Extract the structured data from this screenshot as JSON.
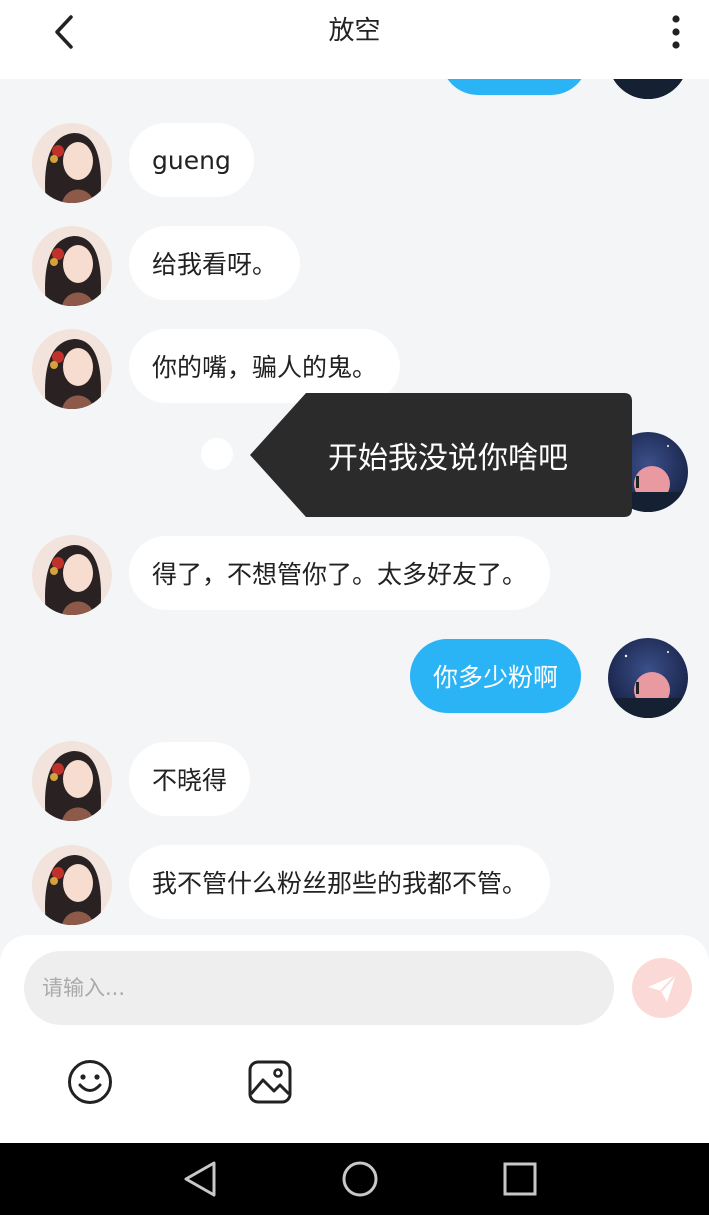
{
  "header": {
    "title": "放空",
    "back_icon": "chevron-left-icon",
    "more_icon": "more-vertical-icon"
  },
  "messages": [
    {
      "direction": "in",
      "text": "gueng"
    },
    {
      "direction": "in",
      "text": "给我看呀。"
    },
    {
      "direction": "in",
      "text": "你的嘴，骗人的鬼。"
    },
    {
      "direction": "out",
      "text": "开始我没说你啥吧"
    },
    {
      "direction": "in",
      "text": "得了，不想管你了。太多好友了。"
    },
    {
      "direction": "out",
      "text": "你多少粉啊"
    },
    {
      "direction": "in",
      "text": "不晓得"
    },
    {
      "direction": "in",
      "text": "我不管什么粉丝那些的我都不管。"
    }
  ],
  "popup": {
    "text": "开始我没说你啥吧"
  },
  "input": {
    "placeholder": "请输入...",
    "value": ""
  },
  "toolbar": {
    "emoji_icon": "smiley-icon",
    "image_icon": "image-icon",
    "send_icon": "send-icon"
  },
  "navbar": {
    "back_icon": "triangle-back-icon",
    "home_icon": "circle-home-icon",
    "recents_icon": "square-recents-icon"
  },
  "colors": {
    "accent": "#2ab3f5",
    "send_button": "#fbd9d6",
    "popup": "#2b2b2b"
  }
}
